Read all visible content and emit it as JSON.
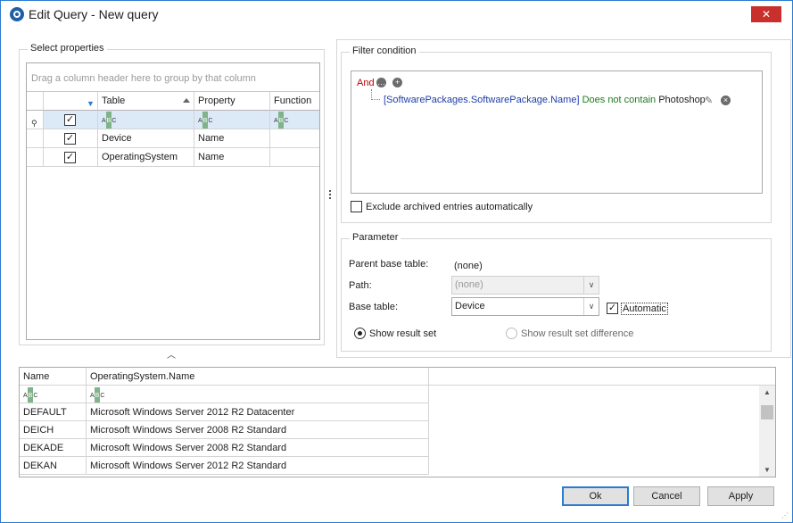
{
  "window": {
    "title": "Edit Query - New query",
    "close_glyph": "✕"
  },
  "select_properties": {
    "legend": "Select properties",
    "group_hint": "Drag a column header here to group by that column",
    "columns": [
      "Table",
      "Property",
      "Function"
    ],
    "rows": [
      {
        "table": "Device",
        "property": "Name",
        "function": "",
        "checked": true
      },
      {
        "table": "OperatingSystem",
        "property": "Name",
        "function": "",
        "checked": true
      }
    ]
  },
  "filter": {
    "legend": "Filter condition",
    "and_label": "And",
    "condition": {
      "field": "[SoftwarePackages.SoftwarePackage.Name]",
      "operator": "Does not contain",
      "value": "Photoshop"
    },
    "exclude_label": "Exclude archived entries automatically"
  },
  "parameter": {
    "legend": "Parameter",
    "parent_base_table_label": "Parent base table:",
    "parent_base_table_value": "(none)",
    "path_label": "Path:",
    "path_value": "(none)",
    "base_table_label": "Base table:",
    "base_table_value": "Device",
    "automatic_label": "Automatic",
    "show_result_set": "Show result set",
    "show_result_diff": "Show result set difference"
  },
  "results": {
    "columns": [
      "Name",
      "OperatingSystem.Name"
    ],
    "rows": [
      [
        "DEFAULT",
        "Microsoft Windows Server 2012 R2 Datacenter"
      ],
      [
        "DEICH",
        "Microsoft Windows Server 2008 R2 Standard"
      ],
      [
        "DEKADE",
        "Microsoft Windows Server 2008 R2 Standard"
      ],
      [
        "DEKAN",
        "Microsoft Windows Server 2012 R2 Standard"
      ]
    ]
  },
  "buttons": {
    "ok": "Ok",
    "cancel": "Cancel",
    "apply": "Apply"
  },
  "colors": {
    "accent": "#2b7bd1",
    "close": "#c9302c",
    "and": "#c00000",
    "field": "#1f3fa6",
    "operator": "#1e7b1e"
  }
}
